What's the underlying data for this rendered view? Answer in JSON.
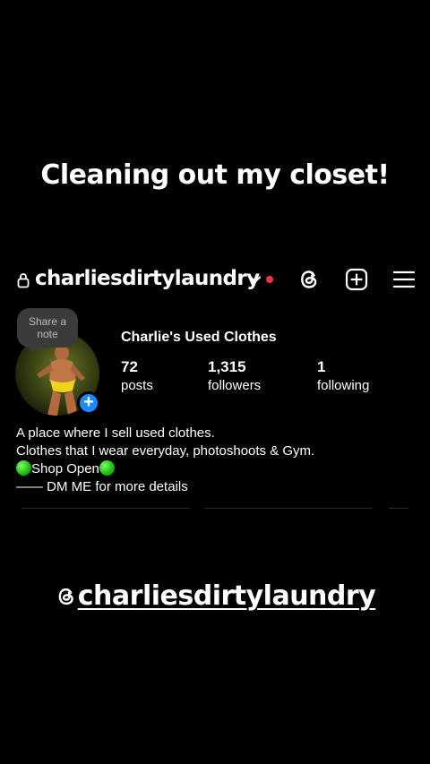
{
  "story": {
    "title": "Cleaning out my closet!",
    "footer_handle": "@charliesdirtylaundry"
  },
  "profile": {
    "username": "charliesdirtylaundry",
    "display_name": "Charlie's Used Clothes",
    "note_label": "Share a note",
    "stats": [
      {
        "value": "72",
        "label": "posts"
      },
      {
        "value": "1,315",
        "label": "followers"
      },
      {
        "value": "1",
        "label": "following"
      }
    ],
    "bio": [
      "A place where I sell used clothes.",
      "Clothes that I wear everyday, photoshoots & Gym.",
      "Shop Open",
      "—— DM ME for more details"
    ]
  },
  "colors": {
    "background": "#000000",
    "notification_dot": "#ff3040",
    "add_story_blue": "#1a8cff",
    "shop_open_emoji": "#20c010"
  },
  "icons": [
    "lock-icon",
    "chevron-down-icon",
    "threads-icon",
    "add-square-icon",
    "hamburger-menu-icon",
    "plus-icon",
    "green-circle-icon"
  ]
}
